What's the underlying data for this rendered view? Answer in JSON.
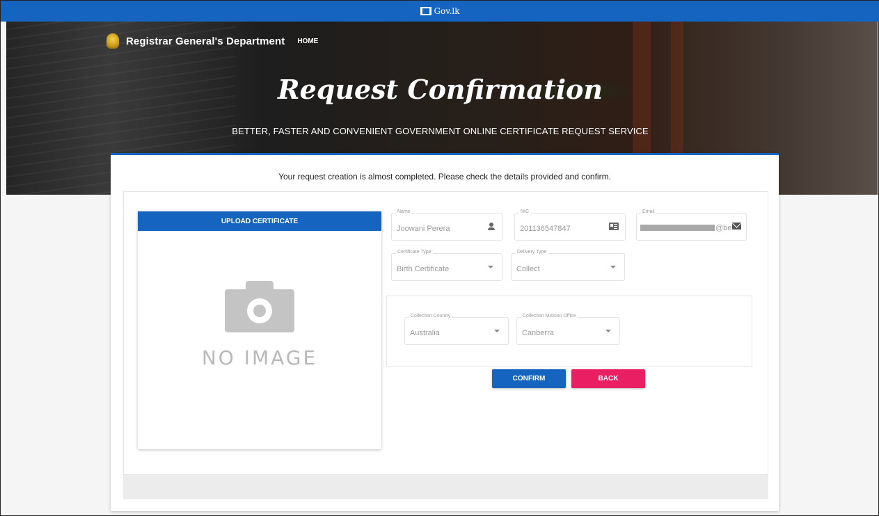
{
  "topbar": {
    "logo_text": "Gov.lk"
  },
  "header": {
    "brand": "Registrar General's Department",
    "nav_home": "HOME"
  },
  "hero": {
    "title": "Request Confirmation",
    "subtitle": "BETTER, FASTER AND CONVENIENT GOVERNMENT ONLINE CERTIFICATE REQUEST SERVICE"
  },
  "intro": "Your request creation is almost completed. Please check the details provided and confirm.",
  "upload": {
    "button_label": "UPLOAD CERTIFICATE",
    "placeholder_text": "NO IMAGE"
  },
  "form": {
    "name": {
      "label": "Name",
      "value": "Joowani Perera",
      "icon": "person-icon"
    },
    "nic": {
      "label": "NIC",
      "value": "201136547847",
      "icon": "id-card-icon"
    },
    "email": {
      "label": "Email",
      "value_suffix": "@be",
      "icon": "mail-icon"
    },
    "certificate_type": {
      "label": "Certificate Type",
      "value": "Birth Certificate"
    },
    "delivery_type": {
      "label": "Delivery Type",
      "value": "Collect"
    },
    "collection_country": {
      "label": "Collection Country",
      "value": "Australia"
    },
    "collection_office": {
      "label": "Collection Mission Office",
      "value": "Canberra"
    }
  },
  "actions": {
    "confirm": "CONFIRM",
    "back": "BACK"
  },
  "colors": {
    "primary": "#1565c0",
    "danger": "#e91e63",
    "background": "#f5f5f5"
  }
}
